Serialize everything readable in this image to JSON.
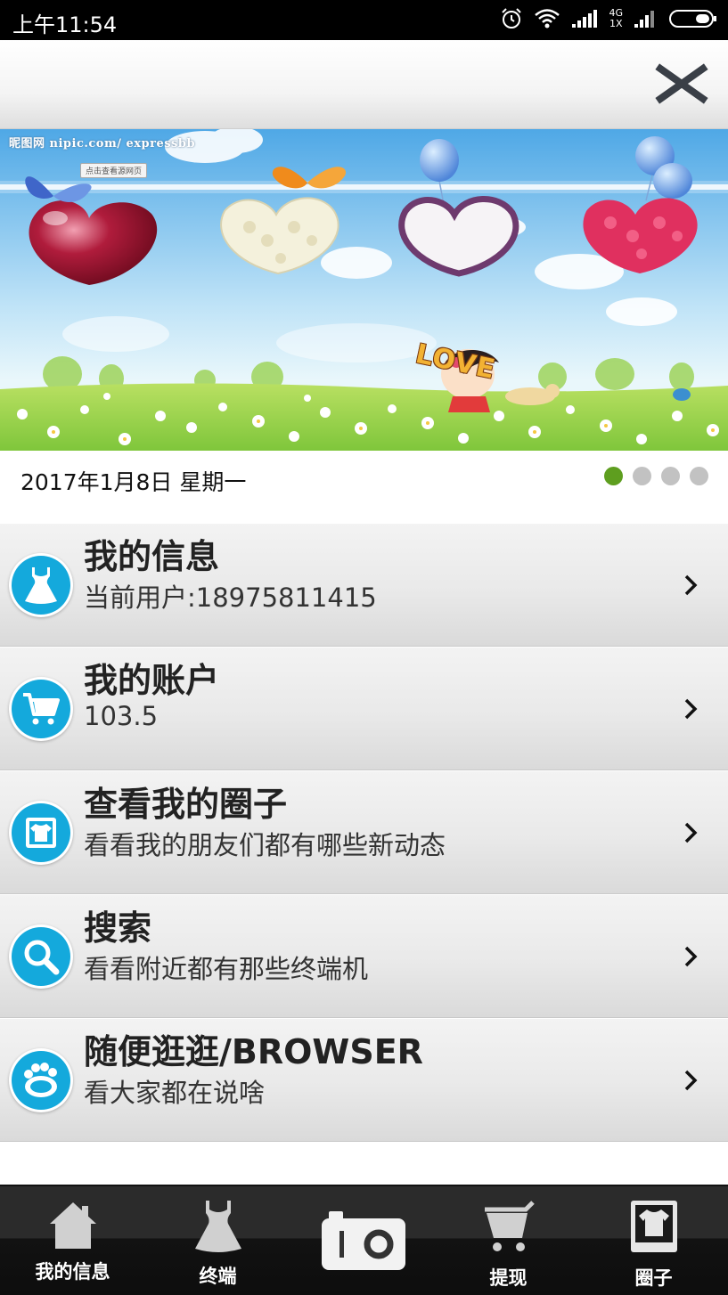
{
  "status_bar": {
    "time": "上午11:54",
    "network_top": "4G",
    "network_bottom": "1X"
  },
  "header": {
    "close_icon": "close-icon"
  },
  "banner": {
    "watermark": "昵图网 nipic.com/ expressbb",
    "watermark_button": "点击查看源网页",
    "love_text": "LOVE"
  },
  "date_row": {
    "date": "2017年1月8日  星期一",
    "carousel_pages": 4,
    "active_page": 1,
    "active_color": "#5e9e1f"
  },
  "menu": {
    "items": [
      {
        "title": "我的信息",
        "subtitle": "当前用户:18975811415",
        "icon": "dress-icon"
      },
      {
        "title": "我的账户",
        "subtitle": "103.5",
        "icon": "cart-icon"
      },
      {
        "title": "查看我的圈子",
        "subtitle": "看看我的朋友们都有哪些新动态",
        "icon": "shirt-frame-icon"
      },
      {
        "title": "搜索",
        "subtitle": "看看附近都有那些终端机",
        "icon": "search-icon"
      },
      {
        "title": "随便逛逛/BROWSER",
        "subtitle": "看大家都在说啥",
        "icon": "paw-icon"
      }
    ],
    "accent_color": "#14a9dc"
  },
  "bottom_nav": {
    "items": [
      {
        "label": "我的信息",
        "icon": "home-icon"
      },
      {
        "label": "终端",
        "icon": "dress-icon"
      },
      {
        "label": "",
        "icon": "camera-icon"
      },
      {
        "label": "提现",
        "icon": "cart-icon"
      },
      {
        "label": "圈子",
        "icon": "shirt-frame-icon"
      }
    ]
  }
}
